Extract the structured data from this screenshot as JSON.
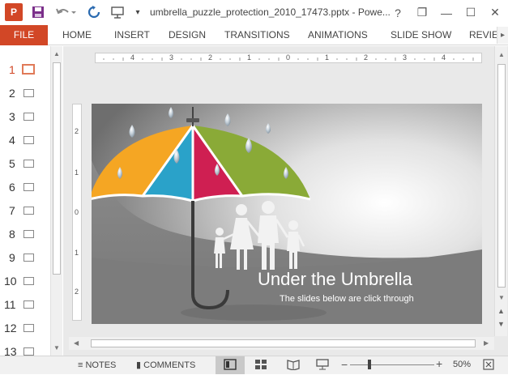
{
  "window": {
    "title": "umbrella_puzzle_protection_2010_17473.pptx - Powe...",
    "app_icon_label": "P",
    "help_label": "?",
    "restore_label": "❐",
    "minimize_label": "—",
    "maximize_label": "☐",
    "close_label": "✕"
  },
  "ribbon": {
    "tabs": [
      "FILE",
      "HOME",
      "INSERT",
      "DESIGN",
      "TRANSITIONS",
      "ANIMATIONS",
      "SLIDE SHOW",
      "REVIEW"
    ]
  },
  "thumbnails": {
    "numbers": [
      "1",
      "2",
      "3",
      "4",
      "5",
      "6",
      "7",
      "8",
      "9",
      "10",
      "11",
      "12",
      "13"
    ],
    "active_index": 1
  },
  "ruler": {
    "horizontal": [
      "4",
      "3",
      "2",
      "1",
      "0",
      "1",
      "2",
      "3",
      "4"
    ],
    "vertical": [
      "2",
      "1",
      "0",
      "1",
      "2"
    ]
  },
  "slide": {
    "title": "Under the Umbrella",
    "subtitle": "The slides below are click through",
    "colors": {
      "orange": "#f5a623",
      "blue": "#2aa2c9",
      "red": "#cf1f52",
      "green": "#8aaa37"
    }
  },
  "statusbar": {
    "notes_label": "NOTES",
    "comments_label": "COMMENTS",
    "zoom_label": "50%"
  },
  "colors": {
    "accent": "#d24726"
  }
}
